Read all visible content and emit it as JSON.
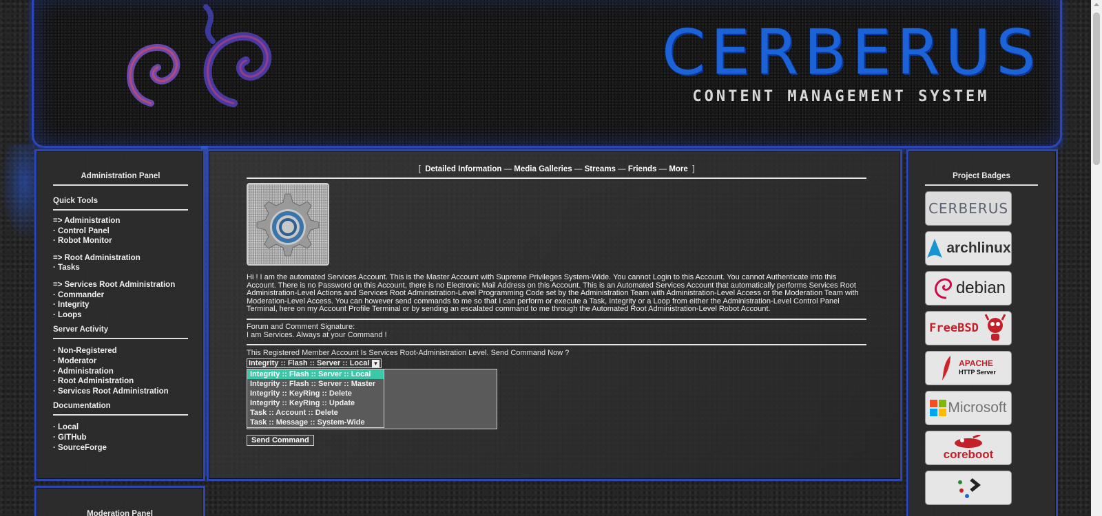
{
  "banner": {
    "title": "CERBERUS",
    "subtitle": "CONTENT MANAGEMENT SYSTEM"
  },
  "admin_panel": {
    "heading": "Administration Panel",
    "quick_tools": {
      "title": "Quick Tools",
      "groups": [
        {
          "head": "=> Administration",
          "items": [
            "· Control Panel",
            "· Robot Monitor"
          ]
        },
        {
          "head": "=> Root Administration",
          "items": [
            "· Tasks"
          ]
        },
        {
          "head": "=> Services Root Administration",
          "items": [
            "· Commander",
            "· Integrity",
            "· Loops"
          ]
        }
      ]
    },
    "server_activity": {
      "title": "Server Activity",
      "items": [
        "· Non-Registered",
        "· Moderator",
        "· Administration",
        "· Root Administration",
        "· Services Root Administration"
      ]
    },
    "documentation": {
      "title": "Documentation",
      "items": [
        "· Local",
        "· GITHub",
        "· SourceForge"
      ]
    }
  },
  "moderation_panel": {
    "heading": "Moderation Panel"
  },
  "profile": {
    "nav": {
      "open": "[",
      "close": "]",
      "sep": "—",
      "items": [
        "Detailed Information",
        "Media Galleries",
        "Streams",
        "Friends",
        "More"
      ]
    },
    "bio": "Hi ! I am the automated Services Account. This is the Master Account with Supreme Privileges System-Wide. You cannot Login to this Account. You cannot Authenticate into this Account. There is no Password on this Account, there is no Electronic Mail Address on this Account. This is an Automated Services Account that automatically performs Services Root Administration-Level Actions and Services Root Administration-Level Programming Code set by the Administration Team with Administration-Level Access or the Moderation Team with Moderation-Level Access. You can however send commands to me so that I can perform or execute a Task, Integrity or a Loop from either the Administration-Level Control Panel Terminal, here on my Account Profile Terminal or by sending an escalated command to me through the Automated Root Administration-Level Robot Account.",
    "signature_label": "Forum and Comment Signature:",
    "signature": "I am Services. Always at your Command !",
    "command_prompt": "This Registered Member Account Is Services Root-Administration Level. Send Command Now ?",
    "select_value": "Integrity :: Flash :: Server :: Local",
    "options": [
      "Integrity :: Flash :: Server :: Local",
      "Integrity :: Flash :: Server :: Master",
      "Integrity :: KeyRing :: Delete",
      "Integrity :: KeyRing :: Update",
      "Task :: Account :: Delete",
      "Task :: Message :: System-Wide"
    ],
    "send_label": "Send Command"
  },
  "badges": {
    "heading": "Project Badges",
    "items": [
      {
        "label": "CERBERUS",
        "icon": "cerberus-badge-icon",
        "color": "#5a6270"
      },
      {
        "label": "archlinux",
        "icon": "archlinux-badge-icon",
        "color": "#1793d1"
      },
      {
        "label": "debian",
        "icon": "debian-badge-icon",
        "color": "#222222"
      },
      {
        "label": "FreeBSD",
        "icon": "freebsd-badge-icon",
        "color": "#c4202a"
      },
      {
        "label": "APACHE",
        "sublabel": "HTTP Server",
        "icon": "apache-badge-icon",
        "color": "#c4202a"
      },
      {
        "label": "Microsoft",
        "icon": "microsoft-badge-icon",
        "color": "#737373"
      },
      {
        "label": "coreboot",
        "icon": "coreboot-badge-icon",
        "color": "#c4202a"
      },
      {
        "label": "",
        "icon": "terminal-badge-icon",
        "color": "#333333"
      }
    ]
  }
}
